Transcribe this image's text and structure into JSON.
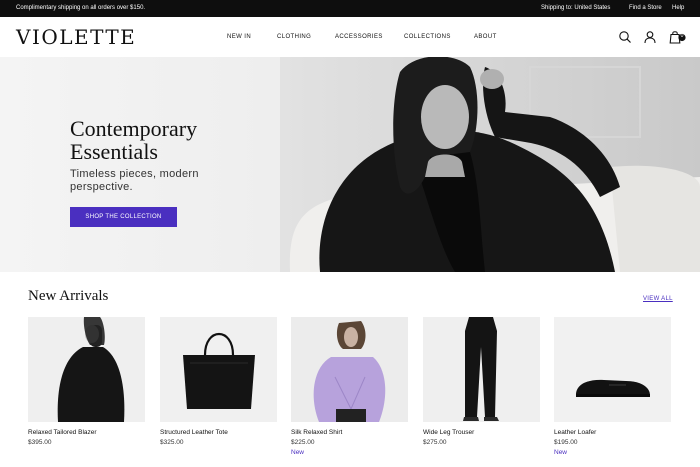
{
  "topbar": {
    "promo": "Complimentary shipping on all orders over $150.",
    "shipping": "Shipping to: United States",
    "find_store": "Find a Store",
    "help": "Help"
  },
  "header": {
    "logo": "VIOLETTE",
    "nav": [
      "NEW IN",
      "CLOTHING",
      "ACCESSORIES",
      "COLLECTIONS",
      "ABOUT"
    ],
    "cart_count": "0",
    "icons": [
      "search-icon",
      "account-icon",
      "cart-icon"
    ]
  },
  "hero": {
    "title_line1": "Contemporary",
    "title_line2": "Essentials",
    "subtitle": "Timeless pieces, modern perspective.",
    "cta": "SHOP THE COLLECTION"
  },
  "new_arrivals": {
    "title": "New Arrivals",
    "view_all": "VIEW ALL",
    "products": [
      {
        "name": "Relaxed Tailored Blazer",
        "price": "$395.00",
        "badge": ""
      },
      {
        "name": "Structured Leather Tote",
        "price": "$325.00",
        "badge": ""
      },
      {
        "name": "Silk Relaxed Shirt",
        "price": "$225.00",
        "badge": "New"
      },
      {
        "name": "Wide Leg Trouser",
        "price": "$275.00",
        "badge": ""
      },
      {
        "name": "Leather Loafer",
        "price": "$195.00",
        "badge": "New"
      }
    ]
  },
  "colors": {
    "accent": "#4a2fc0",
    "topbar": "#0e0e0e"
  }
}
